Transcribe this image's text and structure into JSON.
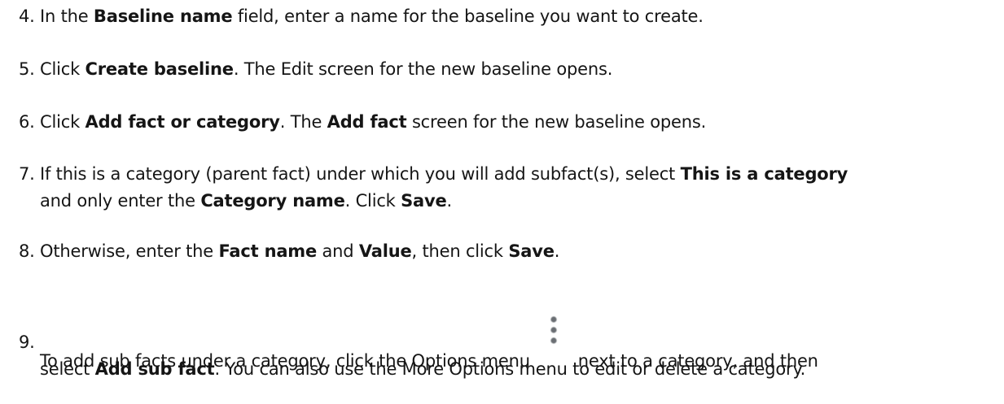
{
  "steps": [
    {
      "number": "4.",
      "lines": [
        [
          {
            "t": "In the "
          },
          {
            "t": "Baseline name",
            "b": true
          },
          {
            "t": " field, enter a name for the baseline you want to create."
          }
        ]
      ]
    },
    {
      "number": "5.",
      "lines": [
        [
          {
            "t": "Click "
          },
          {
            "t": "Create baseline",
            "b": true
          },
          {
            "t": ". The Edit screen for the new baseline opens."
          }
        ]
      ]
    },
    {
      "number": "6.",
      "lines": [
        [
          {
            "t": "Click "
          },
          {
            "t": "Add fact or category",
            "b": true
          },
          {
            "t": ". The "
          },
          {
            "t": "Add fact",
            "b": true
          },
          {
            "t": " screen for the new baseline opens."
          }
        ]
      ]
    },
    {
      "number": "7.",
      "lines": [
        [
          {
            "t": "If this is a category (parent fact) under which you will add subfact(s), select "
          },
          {
            "t": "This is a category",
            "b": true
          }
        ],
        [
          {
            "t": "and only enter the "
          },
          {
            "t": "Category name",
            "b": true
          },
          {
            "t": ". Click "
          },
          {
            "t": "Save",
            "b": true
          },
          {
            "t": "."
          }
        ]
      ]
    },
    {
      "number": "8.",
      "lines": [
        [
          {
            "t": "Otherwise, enter the "
          },
          {
            "t": "Fact name",
            "b": true
          },
          {
            "t": " and "
          },
          {
            "t": "Value",
            "b": true
          },
          {
            "t": ", then click "
          },
          {
            "t": "Save",
            "b": true
          },
          {
            "t": "."
          }
        ]
      ]
    },
    {
      "number": "9.",
      "lines": [
        [
          {
            "t": "To add sub facts under a category, click the Options menu "
          },
          {
            "icon": "kebab-menu-icon"
          },
          {
            "t": " next to a category, and then"
          }
        ],
        [
          {
            "t": "select "
          },
          {
            "t": "Add sub fact",
            "b": true
          },
          {
            "t": ". You can also use the More Options menu to edit or delete a category."
          }
        ]
      ]
    }
  ]
}
